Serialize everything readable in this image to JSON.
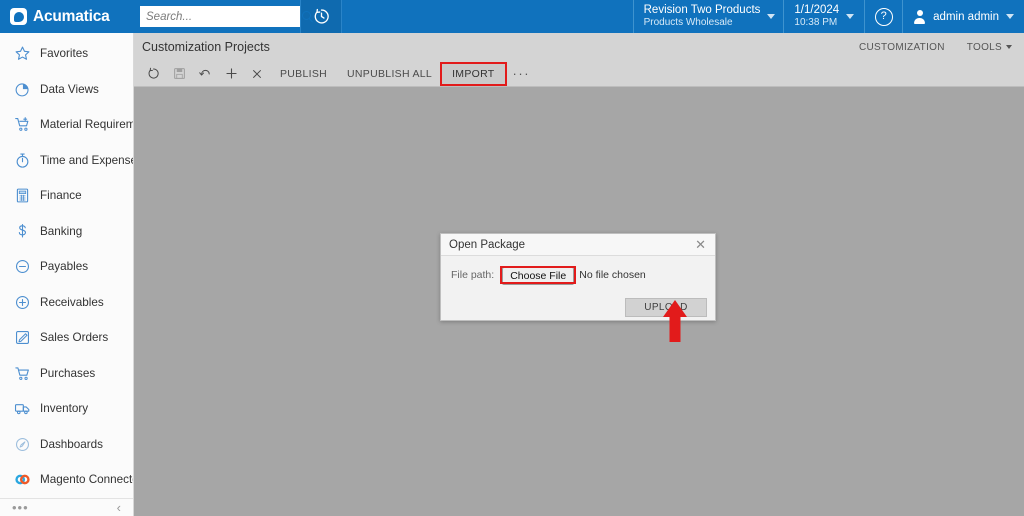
{
  "topbar": {
    "brand": "Acumatica",
    "brand_icon": "acumatica-logo-icon",
    "search": {
      "placeholder": "Search...",
      "value": "",
      "icon": "search-icon"
    },
    "history_icon": "recent-history-clock-icon",
    "company": {
      "name": "Revision Two Products",
      "branch": "Products Wholesale",
      "chevron": "chevron-down-icon"
    },
    "datetime": {
      "date": "1/1/2024",
      "time": "10:38 PM",
      "chevron": "chevron-down-icon"
    },
    "help_icon": "help-question-icon",
    "user": {
      "name": "admin admin",
      "avatar_icon": "user-avatar-icon",
      "chevron": "chevron-down-icon"
    },
    "accent_color": "#1072bd"
  },
  "sidebar": {
    "items": [
      {
        "label": "Favorites",
        "icon": "star-icon"
      },
      {
        "label": "Data Views",
        "icon": "pie-chart-icon"
      },
      {
        "label": "Material Requirem…",
        "icon": "cart-plus-icon"
      },
      {
        "label": "Time and Expenses",
        "icon": "stopwatch-icon"
      },
      {
        "label": "Finance",
        "icon": "calculator-icon"
      },
      {
        "label": "Banking",
        "icon": "dollar-sign-icon"
      },
      {
        "label": "Payables",
        "icon": "circle-minus-icon"
      },
      {
        "label": "Receivables",
        "icon": "circle-plus-icon"
      },
      {
        "label": "Sales Orders",
        "icon": "pencil-square-icon"
      },
      {
        "label": "Purchases",
        "icon": "shopping-cart-icon"
      },
      {
        "label": "Inventory",
        "icon": "delivery-truck-icon"
      },
      {
        "label": "Dashboards",
        "icon": "gauge-icon"
      },
      {
        "label": "Magento Connector",
        "icon": "magento-links-icon"
      }
    ],
    "more_icon": "more-dots-icon",
    "collapse_icon": "chevron-left-icon",
    "icon_color": "#4d8fd0"
  },
  "page": {
    "title": "Customization Projects",
    "header_links": [
      {
        "label": "CUSTOMIZATION",
        "has_caret": false
      },
      {
        "label": "TOOLS",
        "has_caret": true
      }
    ]
  },
  "toolbar": {
    "icon_buttons": [
      {
        "name": "refresh-icon",
        "disabled": false
      },
      {
        "name": "save-icon",
        "disabled": true
      },
      {
        "name": "undo-icon",
        "disabled": false
      },
      {
        "name": "add-icon",
        "disabled": false
      },
      {
        "name": "delete-icon",
        "disabled": false
      }
    ],
    "text_buttons": [
      {
        "label": "PUBLISH",
        "highlighted": false
      },
      {
        "label": "UNPUBLISH ALL",
        "highlighted": false
      },
      {
        "label": "IMPORT",
        "highlighted": true
      }
    ],
    "overflow_label": "···"
  },
  "modal": {
    "title": "Open Package",
    "close_icon": "close-icon",
    "file_path_label": "File path:",
    "choose_file_label": "Choose File",
    "no_file_text": "No file chosen",
    "choose_file_highlighted": true,
    "upload_label": "UPLOAD"
  },
  "annotations": {
    "highlight_color": "#e21b1b",
    "arrow": {
      "name": "red-up-arrow-annotation",
      "points_to": "UPLOAD"
    }
  }
}
